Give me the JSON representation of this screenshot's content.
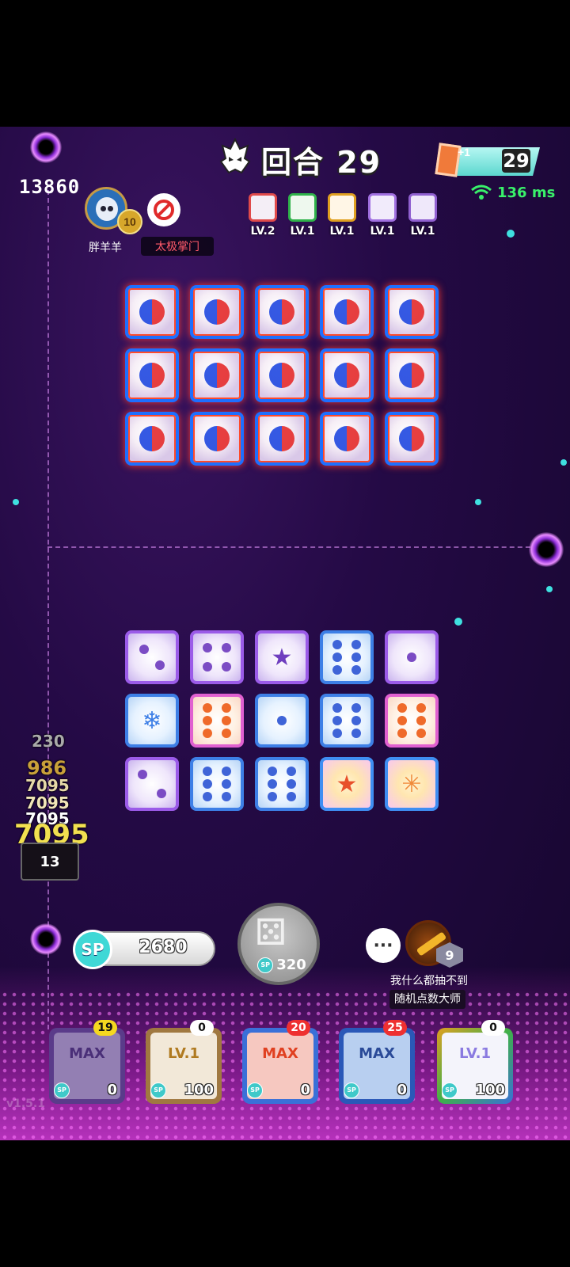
{
  "hud": {
    "score": "13860",
    "round_label": "回合 29",
    "lives_plus": "+1",
    "lives": "29",
    "ping": "136 ms"
  },
  "opponent": {
    "name": "胖羊羊",
    "rank": "10",
    "clan": "太极掌门",
    "deck": [
      {
        "icon": "wind-die-icon",
        "level": "LV.2",
        "color": "#e04a4a"
      },
      {
        "icon": "sprout-die-icon",
        "level": "LV.1",
        "color": "#2fb24a"
      },
      {
        "icon": "infinity-die-icon",
        "level": "LV.1",
        "color": "#e0a020"
      },
      {
        "icon": "purple-die-icon",
        "level": "LV.1",
        "color": "#a070e0"
      },
      {
        "icon": "purple-orb-die-icon",
        "level": "LV.1",
        "color": "#9060d0"
      }
    ]
  },
  "combat_text": {
    "damage_numbers": [
      "230",
      "986",
      "7095",
      "7095",
      "7095",
      "7095"
    ],
    "enemy_hp": "13"
  },
  "player": {
    "sp": "2680",
    "roll_cost": "320",
    "opponent_rank": "9",
    "opponent_title": "我什么都抽不到",
    "opponent_subtitle": "随机点数大师"
  },
  "dice_slots": [
    {
      "title": "MAX",
      "count": "19",
      "cost": "0",
      "badge_color": "#f5d820",
      "frame": "#5a3b8a"
    },
    {
      "title": "LV.1",
      "count": "0",
      "cost": "100",
      "badge_color": "#ffffff",
      "frame": "#a07840"
    },
    {
      "title": "MAX",
      "count": "20",
      "cost": "0",
      "badge_color": "#ee3030",
      "frame": "#3a70d8"
    },
    {
      "title": "MAX",
      "count": "25",
      "cost": "0",
      "badge_color": "#ee3030",
      "frame": "#2a58b8"
    },
    {
      "title": "LV.1",
      "count": "0",
      "cost": "100",
      "badge_color": "#ffffff",
      "frame": "#e0a020"
    }
  ],
  "version": "v1.5.1",
  "sp_icon_label": "SP",
  "colors": {
    "accent_cyan": "#3fd8d6",
    "ping_green": "#39f06a",
    "clan_red": "#ff5a6a"
  }
}
